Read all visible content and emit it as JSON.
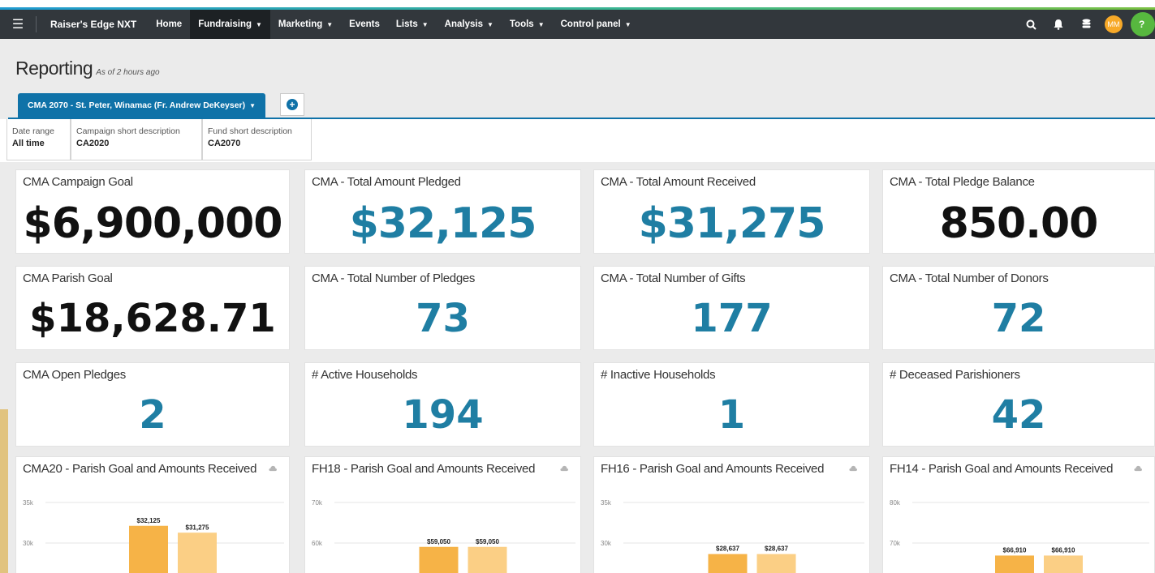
{
  "nav": {
    "brand": "Raiser's Edge NXT",
    "items": [
      {
        "label": "Home",
        "caret": false,
        "active": false
      },
      {
        "label": "Fundraising",
        "caret": true,
        "active": true
      },
      {
        "label": "Marketing",
        "caret": true,
        "active": false
      },
      {
        "label": "Events",
        "caret": false,
        "active": false
      },
      {
        "label": "Lists",
        "caret": true,
        "active": false
      },
      {
        "label": "Analysis",
        "caret": true,
        "active": false
      },
      {
        "label": "Tools",
        "caret": true,
        "active": false
      },
      {
        "label": "Control panel",
        "caret": true,
        "active": false
      }
    ],
    "user_initials": "MM",
    "help_glyph": "?",
    "icons": [
      "search-icon",
      "bell-icon",
      "database-icon"
    ]
  },
  "page": {
    "title": "Reporting",
    "subtitle": "As of 2 hours ago"
  },
  "tabs": {
    "active_label": "CMA 2070 - St. Peter, Winamac (Fr. Andrew DeKeyser)",
    "add_glyph": "+"
  },
  "filters": [
    {
      "label": "Date range",
      "value": "All time"
    },
    {
      "label": "Campaign short description",
      "value": "CA2020"
    },
    {
      "label": "Fund short description",
      "value": "CA2070"
    }
  ],
  "tiles": [
    {
      "title": "CMA Campaign Goal",
      "value": "$6,900,000",
      "color": "#111111"
    },
    {
      "title": "CMA - Total Amount Pledged",
      "value": "$32,125",
      "color": "#1f7ea3"
    },
    {
      "title": "CMA - Total Amount Received",
      "value": "$31,275",
      "color": "#1f7ea3"
    },
    {
      "title": "CMA - Total Pledge Balance",
      "value": "850.00",
      "color": "#111111"
    },
    {
      "title": "CMA Parish Goal",
      "value": "$18,628.71",
      "color": "#111111"
    },
    {
      "title": "CMA - Total Number of Pledges",
      "value": "73",
      "color": "#1f7ea3"
    },
    {
      "title": "CMA - Total Number of Gifts",
      "value": "177",
      "color": "#1f7ea3"
    },
    {
      "title": "CMA - Total Number of Donors",
      "value": "72",
      "color": "#1f7ea3"
    },
    {
      "title": "CMA Open Pledges",
      "value": "2",
      "color": "#1f7ea3"
    },
    {
      "title": "# Active Households",
      "value": "194",
      "color": "#1f7ea3"
    },
    {
      "title": "# Inactive Households",
      "value": "1",
      "color": "#1f7ea3"
    },
    {
      "title": "# Deceased Parishioners",
      "value": "42",
      "color": "#1f7ea3"
    }
  ],
  "chart_data": [
    {
      "type": "bar",
      "title": "CMA20 - Parish Goal and Amounts Received",
      "yticks": [
        "35k",
        "30k"
      ],
      "ylim": [
        25000,
        35000
      ],
      "values": [
        32125,
        31275
      ],
      "data_labels": [
        "$32,125",
        "$31,275"
      ],
      "colors": [
        "#f6b347",
        "#fbcf85"
      ]
    },
    {
      "type": "bar",
      "title": "FH18 - Parish Goal and Amounts Received",
      "yticks": [
        "70k",
        "60k"
      ],
      "ylim": [
        50000,
        70000
      ],
      "values": [
        59050,
        59050
      ],
      "data_labels": [
        "$59,050",
        "$59,050"
      ],
      "colors": [
        "#f6b347",
        "#fbcf85"
      ]
    },
    {
      "type": "bar",
      "title": "FH16 - Parish Goal and Amounts Received",
      "yticks": [
        "35k",
        "30k"
      ],
      "ylim": [
        25000,
        35000
      ],
      "values": [
        28637,
        28637
      ],
      "data_labels": [
        "$28,637",
        "$28,637"
      ],
      "colors": [
        "#f6b347",
        "#fbcf85"
      ]
    },
    {
      "type": "bar",
      "title": "FH14 - Parish Goal and Amounts Received",
      "yticks": [
        "80k",
        "70k"
      ],
      "ylim": [
        60000,
        80000
      ],
      "values": [
        66910,
        66910
      ],
      "data_labels": [
        "$66,910",
        "$66,910"
      ],
      "colors": [
        "#f6b347",
        "#fbcf85"
      ]
    }
  ]
}
